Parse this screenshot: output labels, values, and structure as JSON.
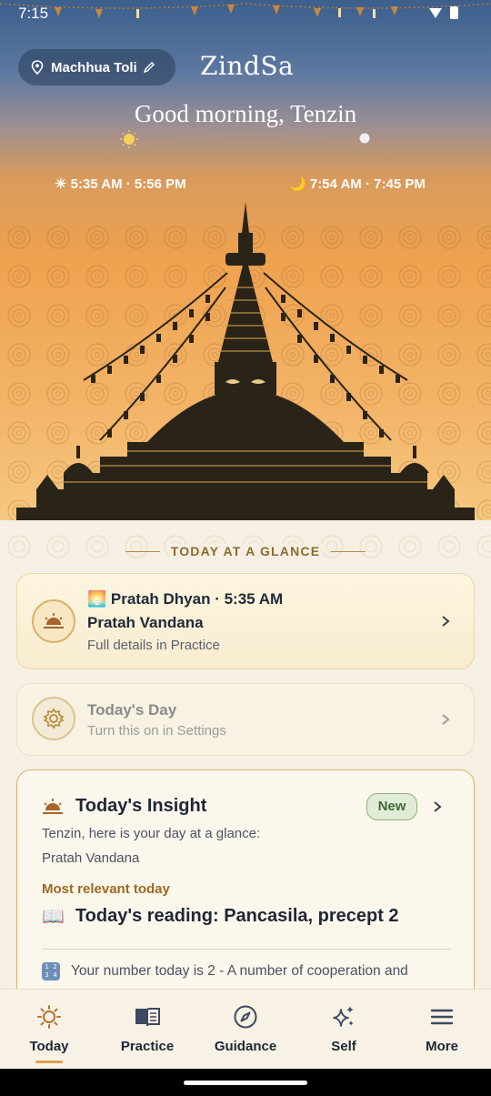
{
  "status_bar": {
    "time": "7:15"
  },
  "header": {
    "location": "Machhua Toli",
    "app_title": "ZindSa",
    "greeting": "Good morning, Tenzin",
    "sun_times": "☀ 5:35 AM · 5:56 PM",
    "moon_times": "🌙 7:54 AM · 7:45 PM"
  },
  "section_heading": "TODAY AT A GLANCE",
  "cards": {
    "practice": {
      "line1": "🌅 Pratah Dhyan · 5:35 AM",
      "line2": "Pratah Vandana",
      "line3": "Full details in Practice",
      "icon": "sunrise-icon"
    },
    "day": {
      "title": "Today's Day",
      "subtitle": "Turn this on in Settings",
      "icon": "gear-icon"
    },
    "insight": {
      "title": "Today's Insight",
      "badge": "New",
      "subtitle": "Tenzin, here is your day at a glance:",
      "practice": "Pratah Vandana",
      "relevant_label": "Most relevant today",
      "reading": "Today's reading: Pancasila, precept 2",
      "reading_icon": "📖",
      "number_text": "Your number today is 2 - A number of cooperation and"
    }
  },
  "nav": {
    "items": [
      {
        "label": "Today",
        "icon": "sun-icon",
        "active": true
      },
      {
        "label": "Practice",
        "icon": "book-icon",
        "active": false
      },
      {
        "label": "Guidance",
        "icon": "compass-icon",
        "active": false
      },
      {
        "label": "Self",
        "icon": "sparkles-icon",
        "active": false
      },
      {
        "label": "More",
        "icon": "menu-icon",
        "active": false
      }
    ]
  },
  "colors": {
    "accent": "#d9a24a",
    "text_dark": "#1f2636",
    "badge_green": "#3f6a35",
    "relevant_label": "#9b6a22"
  }
}
